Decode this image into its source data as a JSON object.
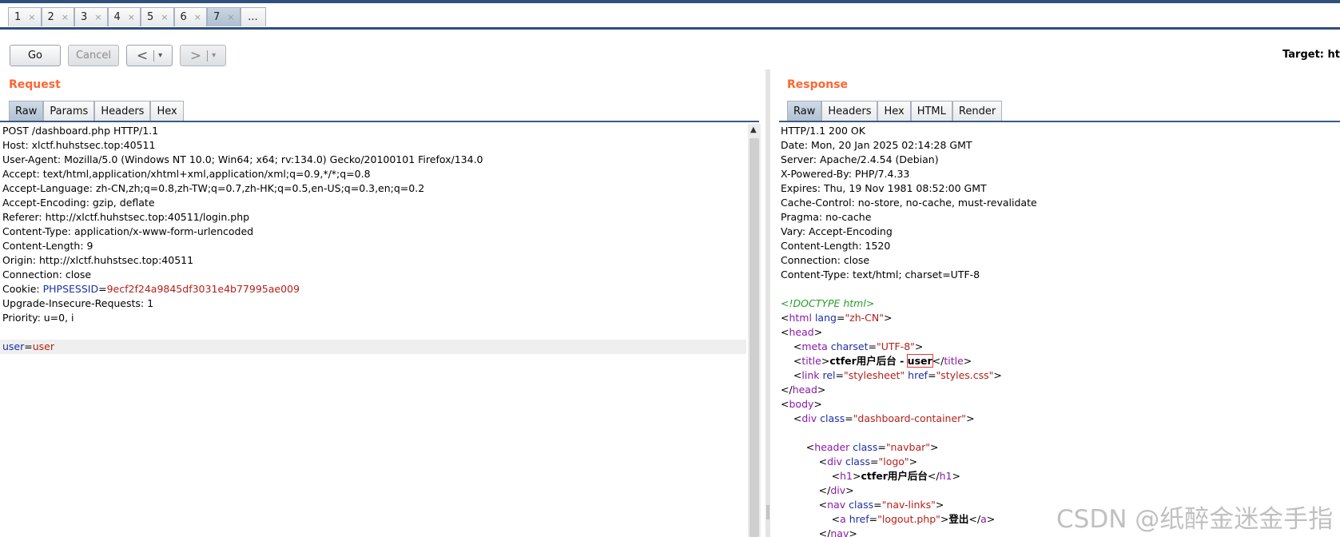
{
  "tabs": [
    {
      "label": "1",
      "close": "×"
    },
    {
      "label": "2",
      "close": "×"
    },
    {
      "label": "3",
      "close": "×"
    },
    {
      "label": "4",
      "close": "×"
    },
    {
      "label": "5",
      "close": "×"
    },
    {
      "label": "6",
      "close": "×"
    },
    {
      "label": "7",
      "close": "×"
    }
  ],
  "more_tab": "...",
  "toolbar": {
    "go": "Go",
    "cancel": "Cancel",
    "back": "<",
    "forward": ">",
    "dropdown": "▾",
    "target": "Target: ht"
  },
  "request": {
    "title": "Request",
    "tabs": [
      "Raw",
      "Params",
      "Headers",
      "Hex"
    ],
    "lines": [
      "POST /dashboard.php HTTP/1.1",
      "Host: xlctf.huhstsec.top:40511",
      "User-Agent: Mozilla/5.0 (Windows NT 10.0; Win64; x64; rv:134.0) Gecko/20100101 Firefox/134.0",
      "Accept: text/html,application/xhtml+xml,application/xml;q=0.9,*/*;q=0.8",
      "Accept-Language: zh-CN,zh;q=0.8,zh-TW;q=0.7,zh-HK;q=0.5,en-US;q=0.3,en;q=0.2",
      "Accept-Encoding: gzip, deflate",
      "Referer: http://xlctf.huhstsec.top:40511/login.php",
      "Content-Type: application/x-www-form-urlencoded",
      "Content-Length: 9",
      "Origin: http://xlctf.huhstsec.top:40511",
      "Connection: close"
    ],
    "cookie_prefix": "Cookie: ",
    "cookie_name": "PHPSESSID",
    "cookie_eq": "=",
    "cookie_value": "9ecf2f24a9845df3031e4b77995ae009",
    "lines_after": [
      "Upgrade-Insecure-Requests: 1",
      "Priority: u=0, i"
    ],
    "body_key": "user",
    "body_eq": "=",
    "body_value": "user"
  },
  "response": {
    "title": "Response",
    "tabs": [
      "Raw",
      "Headers",
      "Hex",
      "HTML",
      "Render"
    ],
    "headers": [
      "HTTP/1.1 200 OK",
      "Date: Mon, 20 Jan 2025 02:14:28 GMT",
      "Server: Apache/2.4.54 (Debian)",
      "X-Powered-By: PHP/7.4.33",
      "Expires: Thu, 19 Nov 1981 08:52:00 GMT",
      "Cache-Control: no-store, no-cache, must-revalidate",
      "Pragma: no-cache",
      "Vary: Accept-Encoding",
      "Content-Length: 1520",
      "Connection: close",
      "Content-Type: text/html; charset=UTF-8"
    ],
    "doctype": "<!DOCTYPE html>",
    "html_attr": "lang",
    "html_lang": "\"zh-CN\"",
    "meta_attr": "charset",
    "meta_val": "\"UTF-8\"",
    "title_text": "ctfer用户后台 - ",
    "title_user": "user",
    "link_rel_attr": "rel",
    "link_rel": "\"stylesheet\"",
    "link_href_attr": "href",
    "link_href": "\"styles.css\"",
    "div_class": "\"dashboard-container\"",
    "header_class": "\"navbar\"",
    "logo_class": "\"logo\"",
    "h1_text": "ctfer用户后台",
    "nav_class": "\"nav-links\"",
    "a_href": "\"logout.php\"",
    "a_text": "登出"
  },
  "watermark": "CSDN @纸醉金迷金手指"
}
